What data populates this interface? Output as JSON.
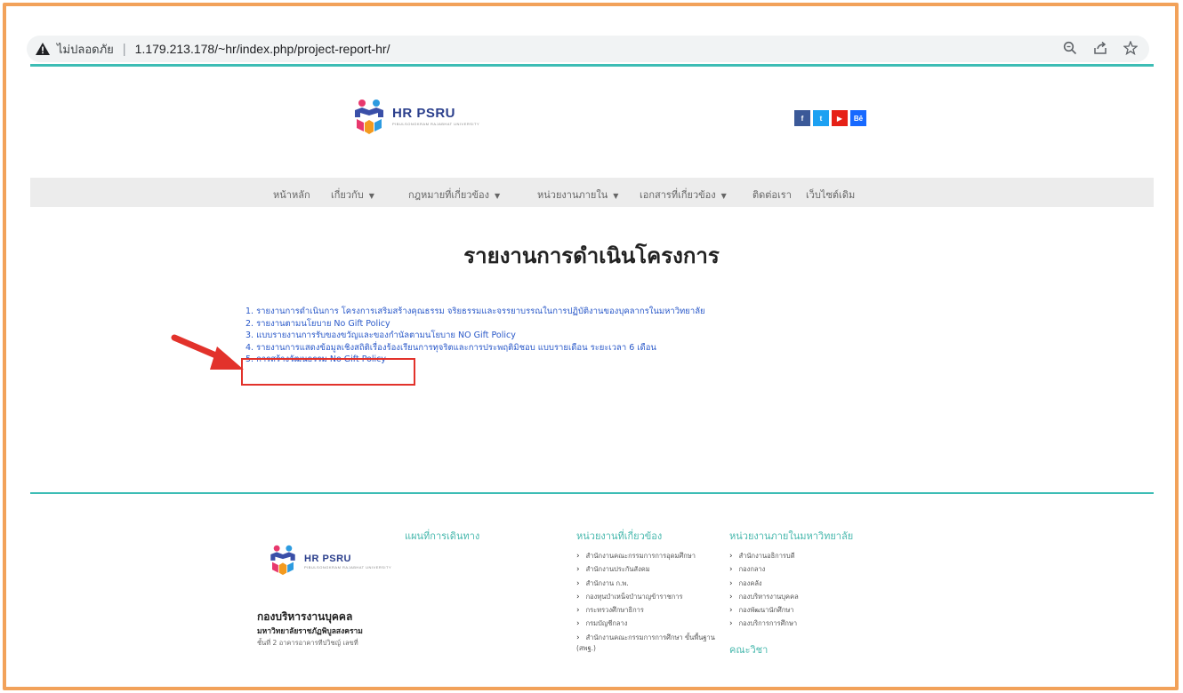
{
  "browser": {
    "insecure_label": "ไม่ปลอดภัย",
    "url": "1.179.213.178/~hr/index.php/project-report-hr/",
    "icons": [
      "warning-icon",
      "zoom-icon",
      "share-icon",
      "bookmark-star-icon"
    ]
  },
  "header": {
    "logo_name": "HR PSRU",
    "logo_sub": "PIBULSONGKRAM RAJABHAT UNIVERSITY",
    "social": [
      {
        "label": "f",
        "color": "#3b5998",
        "icon": "facebook-icon"
      },
      {
        "label": "t",
        "color": "#1da1f2",
        "icon": "twitter-icon"
      },
      {
        "label": "▶",
        "color": "#e62117",
        "icon": "youtube-icon"
      },
      {
        "label": "Bē",
        "color": "#1769ff",
        "icon": "behance-icon"
      }
    ]
  },
  "nav": [
    {
      "label": "หน้าหลัก",
      "caret": false
    },
    {
      "label": "เกี่ยวกับ",
      "caret": true
    },
    {
      "label": "กฎหมายที่เกี่ยวข้อง",
      "caret": true
    },
    {
      "label": "หน่วยงานภายใน",
      "caret": true
    },
    {
      "label": "เอกสารที่เกี่ยวข้อง",
      "caret": true
    },
    {
      "label": "ติดต่อเรา",
      "caret": false
    },
    {
      "label": "เว็บไซต์เดิม",
      "caret": false
    }
  ],
  "page_title": "รายงานการดำเนินโครงการ",
  "links": [
    "1. รายงานการดำเนินการ โครงการเสริมสร้างคุณธรรม จริยธรรมและจรรยาบรรณในการปฏิบัติงานของบุคลากรในมหาวิทยาลัย",
    "2. รายงานตามนโยบาย No Gift Policy",
    "3. แบบรายงานการรับของขวัญและของกำนัลตามนโยบาย NO Gift Policy",
    "4. รายงานการแสดงข้อมูลเชิงสถิติเรื่องร้องเรียนการทุจริตและการประพฤติมิชอบ แบบรายเดือน ระยะเวลา 6 เดือน",
    "5. การสร้างวัฒนธรรม No Gift Policy"
  ],
  "footer": {
    "org_name": "กองบริหารงานบุคคล",
    "org_sub": "มหาวิทยาลัยราชภัฏพิบูลสงคราม",
    "org_addr": "ชั้นที่ 2 อาคารอาคารทีปวิชญ์ เลขที่",
    "map_heading": "แผนที่การเดินทาง",
    "related_heading": "หน่วยงานที่เกี่ยวข้อง",
    "related": [
      "สำนักงานคณะกรรมการการอุดมศึกษา",
      "สำนักงานประกันสังคม",
      "สำนักงาน ก.พ.",
      "กองทุนบำเหน็จบำนาญข้าราชการ",
      "กระทรวงศึกษาธิการ",
      "กรมบัญชีกลาง",
      "สำนักงานคณะกรรมการการศึกษา ขั้นพื้นฐาน (สพฐ.)"
    ],
    "internal_heading": "หน่วยงานภายในมหาวิทยาลัย",
    "internal": [
      "สำนักงานอธิการบดี",
      "กองกลาง",
      "กองคลัง",
      "กองบริหารงานบุคคล",
      "กองพัฒนานักศึกษา",
      "กองบริการการศึกษา"
    ],
    "faculty_heading": "คณะวิชา"
  },
  "colors": {
    "accent": "#3dbdb5",
    "link": "#2a59c9",
    "annotation": "#e2322b",
    "frame": "#f2a25a"
  }
}
